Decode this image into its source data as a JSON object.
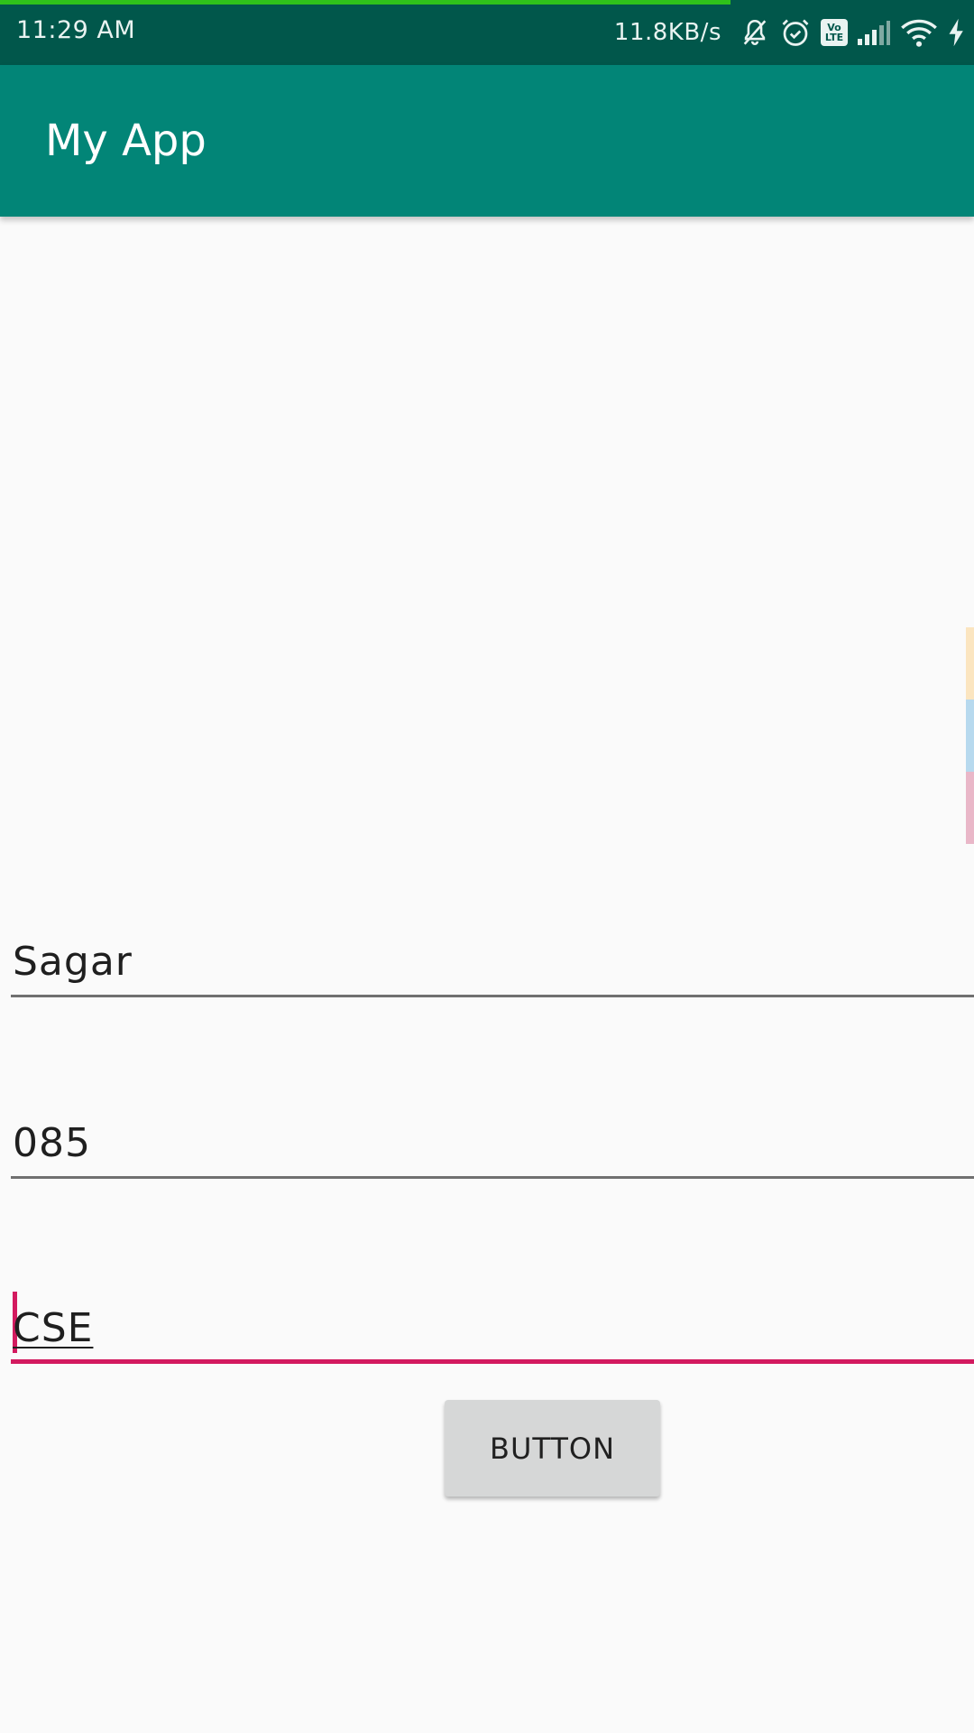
{
  "status_bar": {
    "time": "11:29 AM",
    "net_speed": "11.8KB/s",
    "load_progress": 0.75,
    "icons": [
      "bell-muted-icon",
      "alarm-icon",
      "volte-icon",
      "signal-icon",
      "wifi-icon",
      "charging-icon"
    ],
    "volte_top": "Vo",
    "volte_bottom": "LTE",
    "progress_color": "#2fc21a"
  },
  "app_bar": {
    "title": "My App",
    "color": "#028577"
  },
  "form": {
    "name_value": "Sagar",
    "id_value": "085",
    "branch_value": "CSE",
    "accent_color": "#d31a5f"
  },
  "button": {
    "label": "BUTTON"
  },
  "edge_strip": {
    "colors": [
      "#fbe5c0",
      "#b7d9ee",
      "#e9b7c8"
    ]
  }
}
